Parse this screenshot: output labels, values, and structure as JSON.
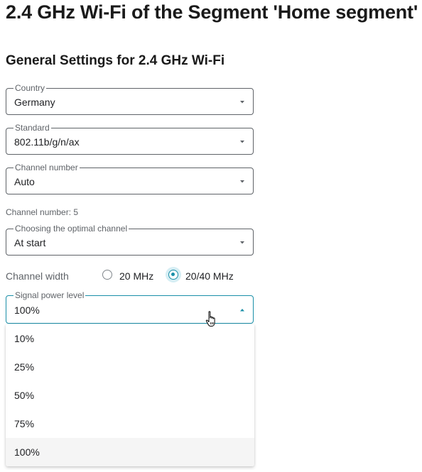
{
  "page": {
    "title": "2.4 GHz Wi-Fi of the Segment 'Home segment'"
  },
  "general_settings": {
    "title": "General Settings for 2.4 GHz Wi-Fi"
  },
  "fields": {
    "country": {
      "label": "Country",
      "value": "Germany"
    },
    "standard": {
      "label": "Standard",
      "value": "802.11b/g/n/ax"
    },
    "channel_number": {
      "label": "Channel number",
      "value": "Auto"
    },
    "channel_info": "Channel number: 5",
    "optimal_channel": {
      "label": "Choosing the optimal channel",
      "value": "At start"
    },
    "signal_power": {
      "label": "Signal power level",
      "value": "100%"
    }
  },
  "channel_width": {
    "label": "Channel width",
    "options": [
      "20 MHz",
      "20/40 MHz"
    ],
    "selected": "20/40 MHz"
  },
  "signal_power_options": [
    "10%",
    "25%",
    "50%",
    "75%",
    "100%"
  ],
  "colors": {
    "accent": "#1a8fa8",
    "border": "#5f6368",
    "selected_option_bg": "#f5f5f5"
  },
  "icons": {
    "caret_closed": "caret-down-icon",
    "caret_open": "caret-up-icon",
    "pointer": "hand-cursor-icon"
  }
}
